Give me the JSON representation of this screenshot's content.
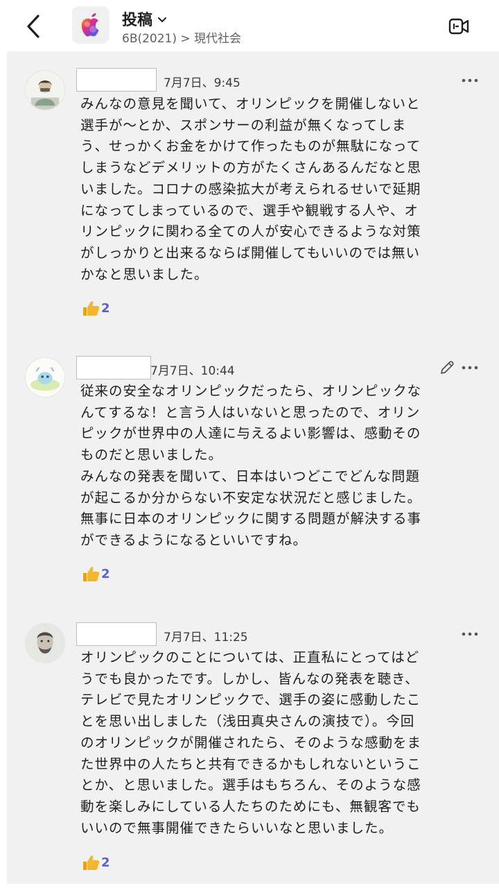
{
  "header": {
    "title": "投稿",
    "subtitle": "6B(2021) > 現代社会"
  },
  "posts": [
    {
      "time": "7月7日、9:45",
      "text": "みんなの意見を聞いて、オリンピックを開催しないと\n選手が〜とか、スポンサーの利益が無くなってしま\nう、せっかくお金をかけて作ったものが無駄になって\nしまうなどデメリットの方がたくさんあるんだなと思\nいました。コロナの感染拡大が考えられるせいで延期\nになってしまっているので、選手や観戦する人や、オ\nリンピックに関わる全ての人が安心できるような対策\nがしっかりと出来るならば開催してもいいのでは無い\nかなと思いました。",
      "reaction_count": "2"
    },
    {
      "time": "7月7日、10:44",
      "text": "従来の安全なオリンピックだったら、オリンピックな\nんてするな！と言う人はいないと思ったので、オリン\nピックが世界中の人達に与えるよい影響は、感動その\nものだと思いました。\nみんなの発表を聞いて、日本はいつどこでどんな問題\nが起こるか分からない不安定な状況だと感じました。\n無事に日本のオリンピックに関する問題が解決する事\nができるようになるといいですね。",
      "reaction_count": "2"
    },
    {
      "time": "7月7日、11:25",
      "text": "オリンピックのことについては、正直私にとってはど\nうでも良かったです。しかし、皆んなの発表を聴き、\nテレビで見たオリンピックで、選手の姿に感動したこ\nとを思い出しました（浅田真央さんの演技で）。今回\nのオリンピックが開催されたら、そのような感動をま\nた世界中の人たちと共有できるかもしれないというこ\nとか、と思いました。選手はもちろん、そのような感\n動を楽しみにしている人たちのためにも、無観客でも\nいいので無事開催できたらいいなと思いました。",
      "reaction_count": "2"
    }
  ],
  "colors": {
    "accent": "#5b5fc7",
    "feed_background": "#f2f1f1",
    "like_yellow": "#f2b632"
  },
  "icons": [
    "back-chevron-icon",
    "apple-logo-icon",
    "chevron-down-icon",
    "video-call-icon",
    "more-icon",
    "edit-pencil-icon",
    "thumbs-up-icon"
  ]
}
